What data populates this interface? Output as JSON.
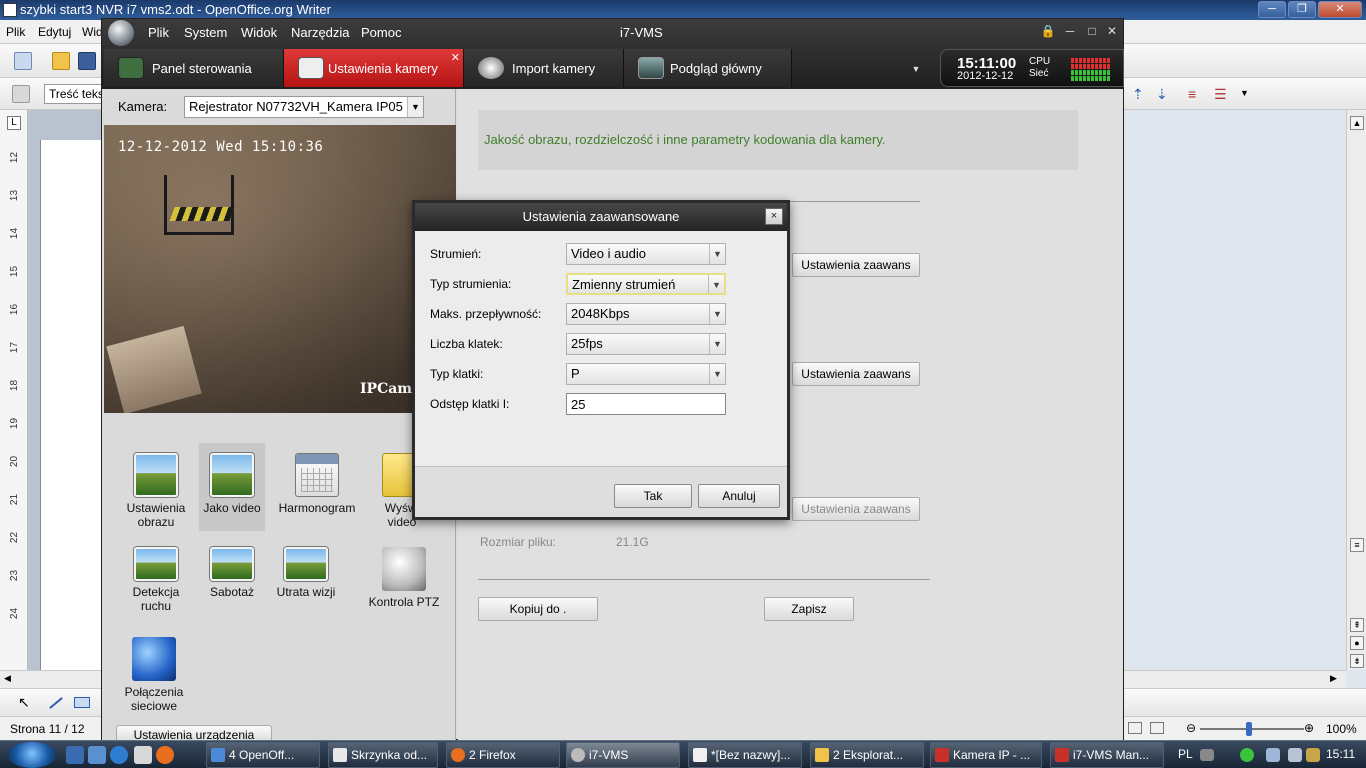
{
  "openoffice": {
    "window_title": "szybki start3 NVR i7 vms2.odt - OpenOffice.org Writer",
    "menu": [
      "Plik",
      "Edytuj",
      "Wid"
    ],
    "paragraph_style": "Treść teks",
    "ruler_numbers": [
      "12",
      "13",
      "14",
      "15",
      "16",
      "17",
      "18",
      "19",
      "20",
      "21",
      "22",
      "23",
      "24"
    ],
    "status_page": "Strona 11 / 12",
    "zoom": "100%"
  },
  "vms": {
    "title": "i7-VMS",
    "menu": [
      "Plik",
      "System",
      "Widok",
      "Narzędzia",
      "Pomoc"
    ],
    "tabs": [
      {
        "label": "Panel sterowania"
      },
      {
        "label": "Ustawienia kamery"
      },
      {
        "label": "Import kamery"
      },
      {
        "label": "Podgląd główny"
      }
    ],
    "clock": {
      "time": "15:11:00",
      "date": "2012-12-12",
      "cpu_label": "CPU",
      "net_label": "Sieć"
    },
    "camera_label": "Kamera:",
    "camera_value": "Rejestrator N07732VH_Kamera IP05",
    "osd_text": "12-12-2012 Wed 15:10:36",
    "osd_brand": "IPCamer",
    "functions": [
      {
        "label": "Ustawienia obrazu"
      },
      {
        "label": "Jako video"
      },
      {
        "label": "Harmonogram"
      },
      {
        "label": "Wyświ video"
      },
      {
        "label": "Detekcja ruchu"
      },
      {
        "label": "Sabotaż"
      },
      {
        "label": "Utrata wizji"
      },
      {
        "label": "Kontrola PTZ"
      },
      {
        "label": "Połączenia sieciowe"
      }
    ],
    "device_settings_button": "Ustawienia urządzenia",
    "info_text": "Jakość obrazu, rozdzielczość i inne parametry kodowania dla kamery.",
    "advanced_button": "Ustawienia zaawans",
    "file_size_label": "Rozmiar pliku:",
    "file_size_value": "21.1G",
    "copy_button": "Kopiuj do .",
    "save_button": "Zapisz"
  },
  "dialog": {
    "title": "Ustawienia zaawansowane",
    "close": "×",
    "fields": [
      {
        "label": "Strumień:",
        "value": "Video i audio"
      },
      {
        "label": "Typ strumienia:",
        "value": "Zmienny strumień"
      },
      {
        "label": "Maks. przepływność:",
        "value": "2048Kbps"
      },
      {
        "label": "Liczba klatek:",
        "value": "25fps"
      },
      {
        "label": "Typ klatki:",
        "value": "P"
      },
      {
        "label": "Odstęp klatki I:",
        "value": "25"
      }
    ],
    "ok": "Tak",
    "cancel": "Anuluj"
  },
  "taskbar": {
    "items": [
      {
        "label": "4 OpenOff..."
      },
      {
        "label": "Skrzynka od..."
      },
      {
        "label": "2 Firefox"
      },
      {
        "label": "i7-VMS"
      },
      {
        "label": "*[Bez nazwy]..."
      },
      {
        "label": "2 Eksplorat..."
      },
      {
        "label": "Kamera IP - ..."
      },
      {
        "label": "i7-VMS Man..."
      }
    ],
    "language": "PL",
    "time": "15:11"
  }
}
